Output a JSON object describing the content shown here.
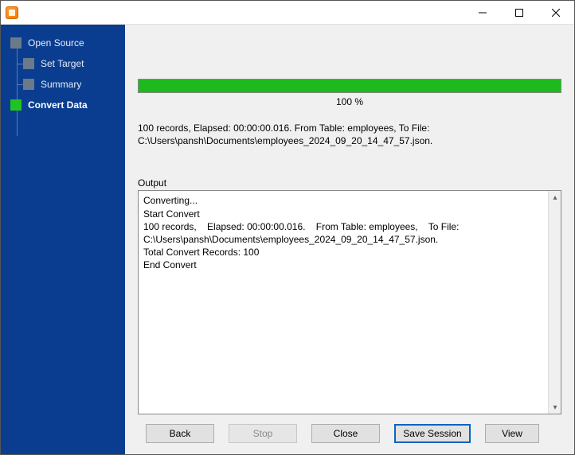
{
  "sidebar": {
    "steps": [
      {
        "label": "Open Source"
      },
      {
        "label": "Set Target"
      },
      {
        "label": "Summary"
      },
      {
        "label": "Convert Data"
      }
    ]
  },
  "progress": {
    "percent_text": "100 %"
  },
  "status": {
    "line": "100 records,    Elapsed: 00:00:00.016.    From Table: employees,    To File: C:\\Users\\pansh\\Documents\\employees_2024_09_20_14_47_57.json."
  },
  "output": {
    "label": "Output",
    "log": "Converting...\nStart Convert\n100 records,    Elapsed: 00:00:00.016.    From Table: employees,    To File: C:\\Users\\pansh\\Documents\\employees_2024_09_20_14_47_57.json.\nTotal Convert Records: 100\nEnd Convert"
  },
  "buttons": {
    "back": "Back",
    "stop": "Stop",
    "close": "Close",
    "save_session": "Save Session",
    "view": "View"
  }
}
